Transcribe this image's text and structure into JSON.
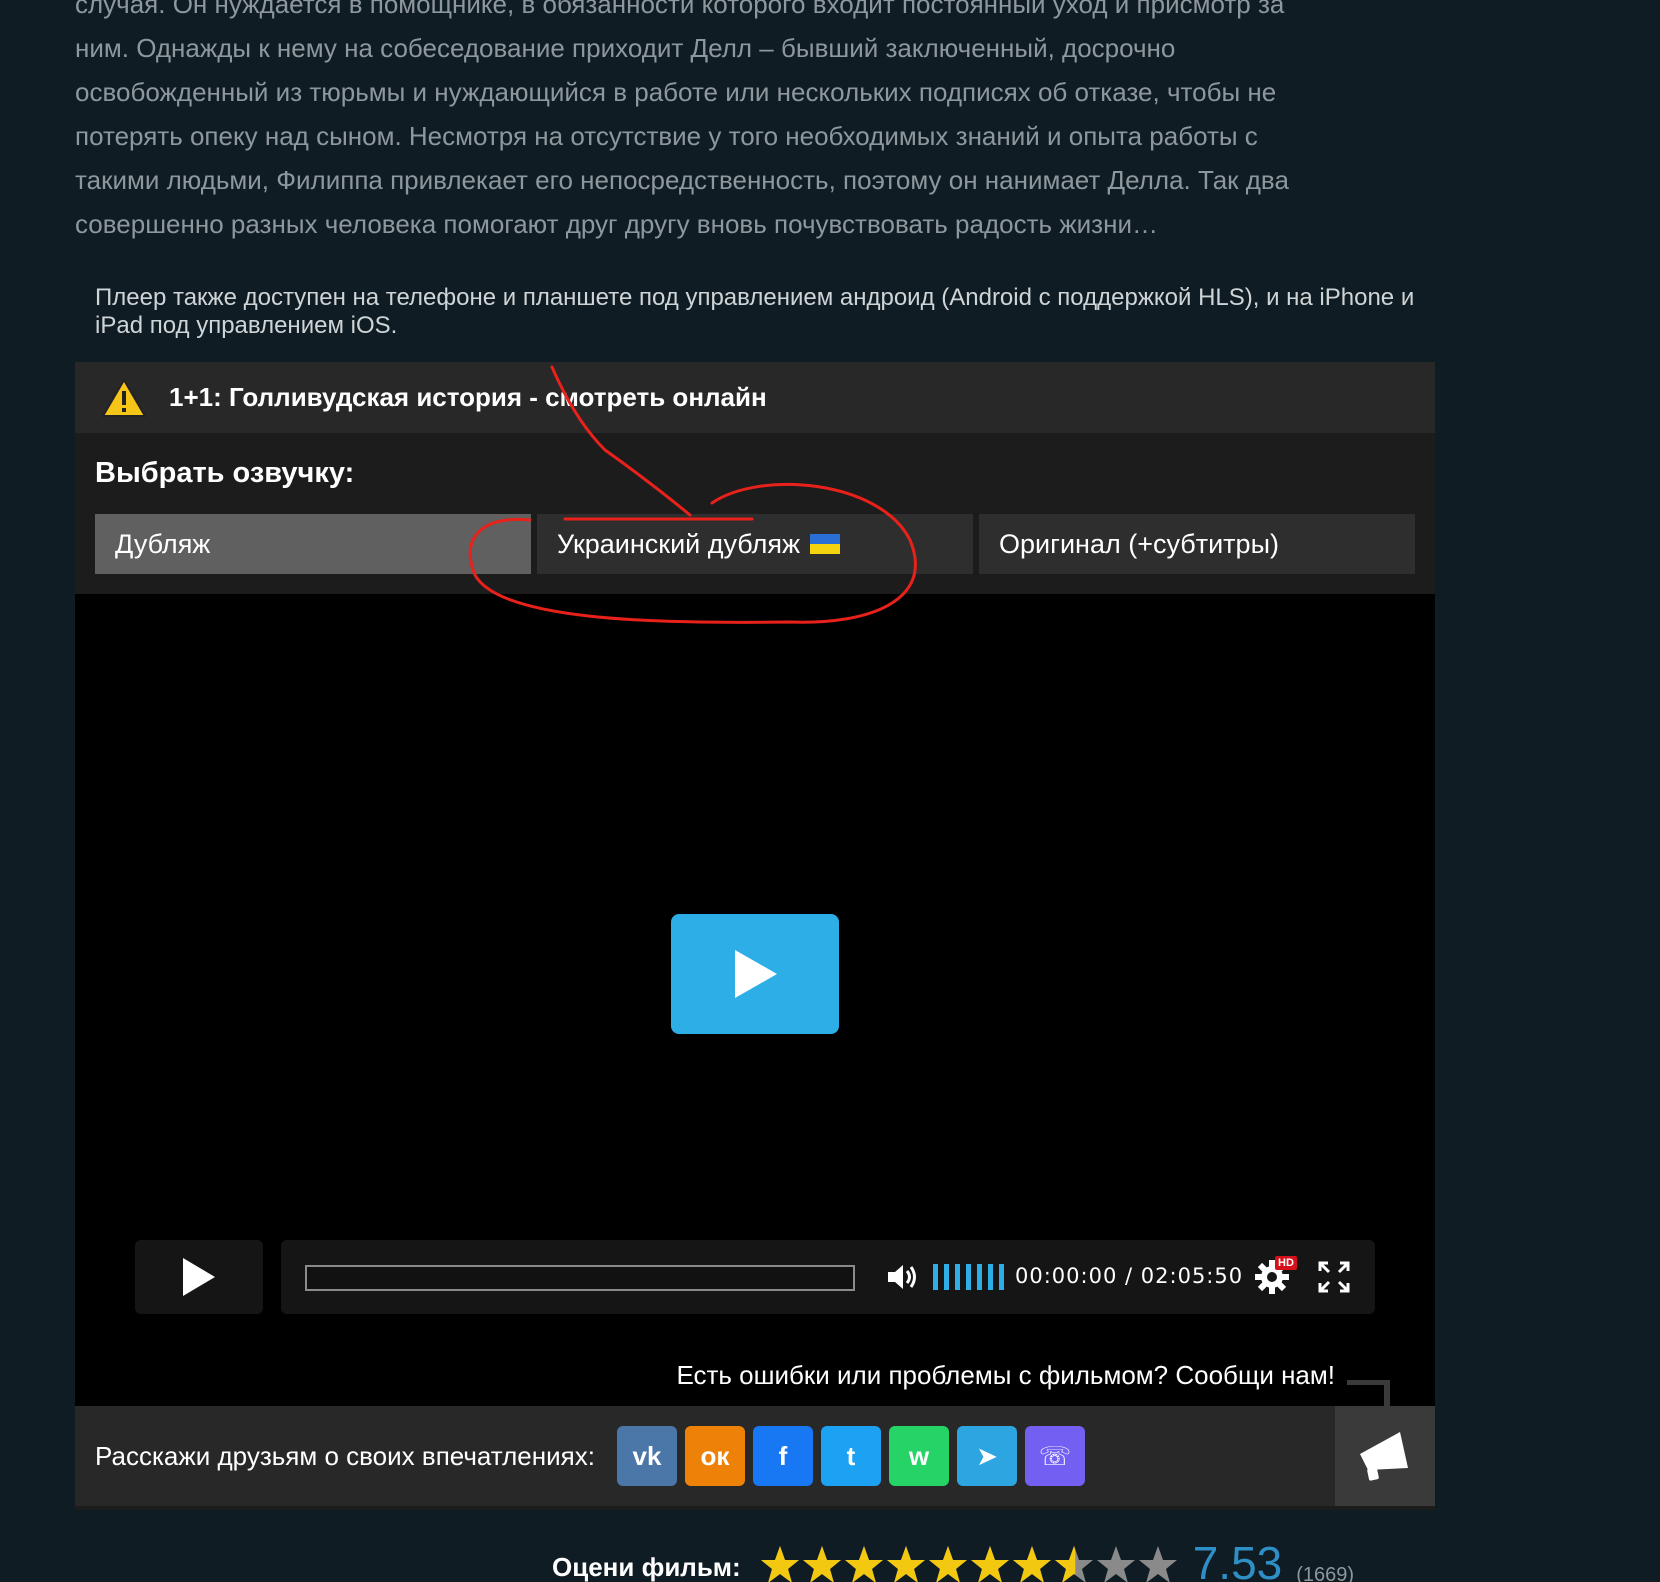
{
  "description": {
    "lines": [
      "случая. Он нуждается в помощнике, в обязанности которого входит постоянный уход и присмотр за",
      "ним. Однажды к нему на собеседование приходит Делл – бывший заключенный, досрочно",
      "освобожденный из тюрьмы и нуждающийся в работе или нескольких подписях об отказе, чтобы не",
      "потерять опеку над сыном. Несмотря на отсутствие у того необходимых знаний и опыта работы с",
      "такими людьми, Филиппа привлекает его непосредственность, поэтому он нанимает Делла. Так два",
      "совершенно разных человека помогают друг другу вновь почувствовать радость жизни…"
    ]
  },
  "player_note": "Плеер также доступен на телефоне и планшете под управлением андроид (Android с поддержкой HLS), и на iPhone и iPad под управлением iOS.",
  "panel": {
    "title": "1+1: Голливудская история - смотреть онлайн",
    "voice_label": "Выбрать озвучку:",
    "voice_tabs": [
      {
        "label": "Дубляж",
        "active": true
      },
      {
        "label": "Украинский дубляж",
        "active": false,
        "flag": "ukraine-flag-icon"
      },
      {
        "label": "Оригинал (+субтитры)",
        "active": false
      }
    ]
  },
  "player": {
    "time_current": "00:00:00",
    "time_separator": "/",
    "time_total": "02:05:50",
    "progress_fraction": 0,
    "hd_badge": "HD",
    "accent_color": "#2eaee6"
  },
  "report_text": "Есть ошибки или проблемы с фильмом? Сообщи нам!",
  "share": {
    "label": "Расскажи друзьям о своих впечатлениях:",
    "networks": [
      {
        "name": "vk-icon",
        "color": "#4a76a8",
        "glyph": "vk"
      },
      {
        "name": "odnoklassniki-icon",
        "color": "#ee8208",
        "glyph": "ок"
      },
      {
        "name": "facebook-icon",
        "color": "#1877f2",
        "glyph": "f"
      },
      {
        "name": "twitter-icon",
        "color": "#1da1f2",
        "glyph": "t"
      },
      {
        "name": "whatsapp-icon",
        "color": "#25d366",
        "glyph": "w"
      },
      {
        "name": "telegram-icon",
        "color": "#2ca5e0",
        "glyph": "➤"
      },
      {
        "name": "viber-icon",
        "color": "#7360f2",
        "glyph": "☏"
      }
    ]
  },
  "rating": {
    "label": "Оцени фильм:",
    "value": "7.53",
    "count": "(1669)",
    "score": 7.53,
    "max": 10
  }
}
